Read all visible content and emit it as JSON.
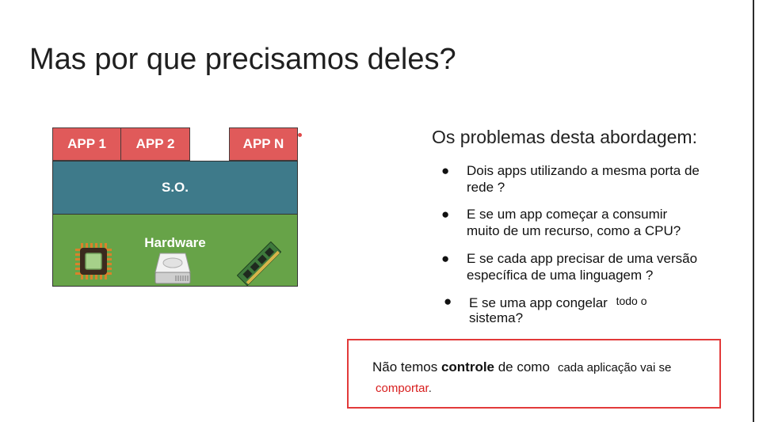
{
  "slide": {
    "title": "Mas por que precisamos deles?",
    "diagram": {
      "apps": [
        "APP 1",
        "APP 2",
        "APP N"
      ],
      "os_label": "S.O.",
      "hardware_label": "Hardware",
      "icons": [
        "cpu-chip-icon",
        "hard-drive-icon",
        "ram-module-icon"
      ],
      "colors": {
        "app": "#e05a5a",
        "os": "#3e7a8a",
        "hardware": "#67a348"
      }
    },
    "problems_heading": "Os problemas desta abordagem:",
    "bullets": [
      {
        "line1": "Dois apps utilizando a mesma porta de",
        "line2": "rede ?"
      },
      {
        "line1": "E se um app começar a consumir",
        "line2": "muito de um recurso, como a CPU?"
      },
      {
        "line1": "E se cada app precisar de uma versão",
        "line2": "específica de uma linguagem ?"
      },
      {
        "line1": "E se uma app congelar",
        "line1_small": "todo o",
        "line2": "sistema?"
      }
    ],
    "callout": {
      "prefix": "Não temos ",
      "bold": "controle",
      "middle": " de como",
      "small": "cada aplicação vai se",
      "line2": "comportar",
      "line2_end": "."
    }
  }
}
